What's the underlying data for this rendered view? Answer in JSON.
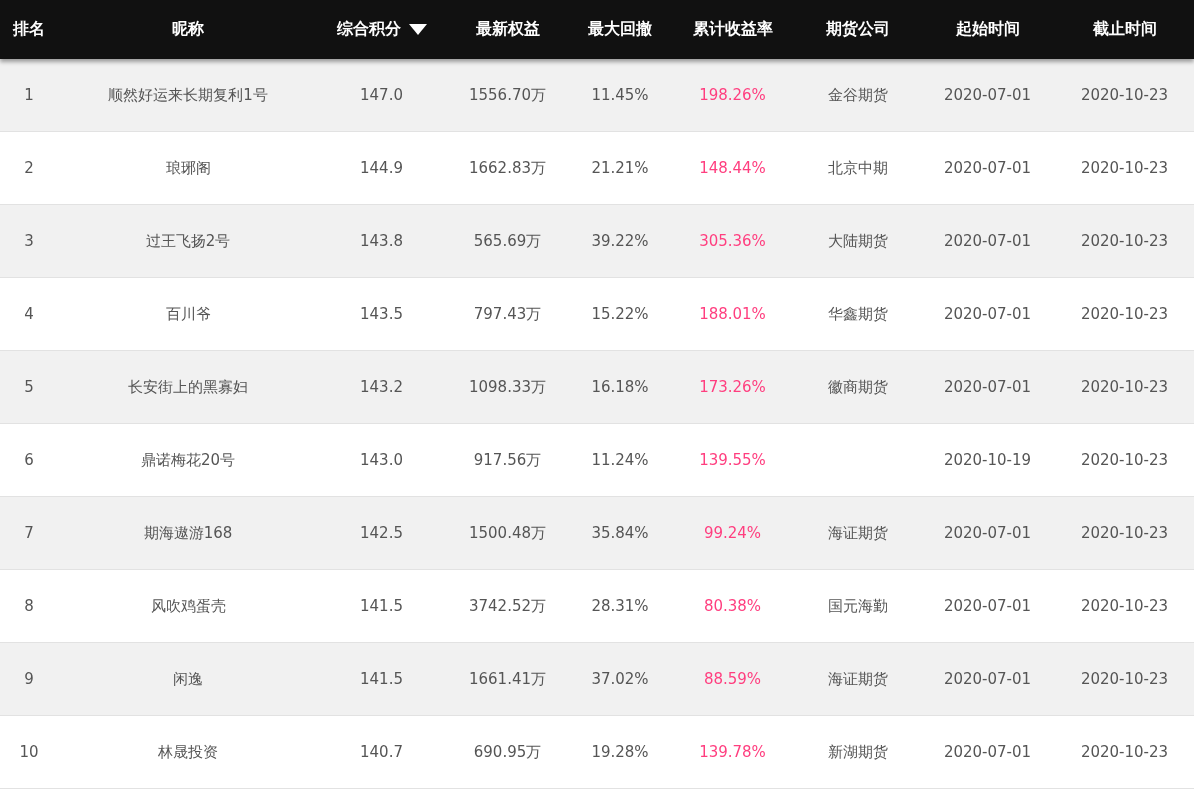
{
  "table": {
    "columns": [
      {
        "label": "排名",
        "sorted": false
      },
      {
        "label": "昵称",
        "sorted": false
      },
      {
        "label": "综合积分",
        "sorted": true
      },
      {
        "label": "最新权益",
        "sorted": false
      },
      {
        "label": "最大回撤",
        "sorted": false
      },
      {
        "label": "累计收益率",
        "sorted": false
      },
      {
        "label": "期货公司",
        "sorted": false
      },
      {
        "label": "起始时间",
        "sorted": false
      },
      {
        "label": "截止时间",
        "sorted": false
      }
    ],
    "rows": [
      {
        "rank": "1",
        "name": "顺然好运来长期复利1号",
        "score": "147.0",
        "equity": "1556.70万",
        "drawdown": "11.45%",
        "return": "198.26%",
        "company": "金谷期货",
        "start": "2020-07-01",
        "end": "2020-10-23"
      },
      {
        "rank": "2",
        "name": "琅琊阁",
        "score": "144.9",
        "equity": "1662.83万",
        "drawdown": "21.21%",
        "return": "148.44%",
        "company": "北京中期",
        "start": "2020-07-01",
        "end": "2020-10-23"
      },
      {
        "rank": "3",
        "name": "过王飞扬2号",
        "score": "143.8",
        "equity": "565.69万",
        "drawdown": "39.22%",
        "return": "305.36%",
        "company": "大陆期货",
        "start": "2020-07-01",
        "end": "2020-10-23"
      },
      {
        "rank": "4",
        "name": "百川爷",
        "score": "143.5",
        "equity": "797.43万",
        "drawdown": "15.22%",
        "return": "188.01%",
        "company": "华鑫期货",
        "start": "2020-07-01",
        "end": "2020-10-23"
      },
      {
        "rank": "5",
        "name": "长安街上的黑寡妇",
        "score": "143.2",
        "equity": "1098.33万",
        "drawdown": "16.18%",
        "return": "173.26%",
        "company": "徽商期货",
        "start": "2020-07-01",
        "end": "2020-10-23"
      },
      {
        "rank": "6",
        "name": "鼎诺梅花20号",
        "score": "143.0",
        "equity": "917.56万",
        "drawdown": "11.24%",
        "return": "139.55%",
        "start": "2020-10-19",
        "end": "2020-10-23"
      },
      {
        "rank": "7",
        "name": "期海遨游168",
        "score": "142.5",
        "equity": "1500.48万",
        "drawdown": "35.84%",
        "return": "99.24%",
        "company": "海证期货",
        "start": "2020-07-01",
        "end": "2020-10-23"
      },
      {
        "rank": "8",
        "name": "风吹鸡蛋壳",
        "score": "141.5",
        "equity": "3742.52万",
        "drawdown": "28.31%",
        "return": "80.38%",
        "company": "国元海勤",
        "start": "2020-07-01",
        "end": "2020-10-23"
      },
      {
        "rank": "9",
        "name": "闲逸",
        "score": "141.5",
        "equity": "1661.41万",
        "drawdown": "37.02%",
        "return": "88.59%",
        "company": "海证期货",
        "start": "2020-07-01",
        "end": "2020-10-23"
      },
      {
        "rank": "10",
        "name": "林晟投资",
        "score": "140.7",
        "equity": "690.95万",
        "drawdown": "19.28%",
        "return": "139.78%",
        "company": "新湖期货",
        "start": "2020-07-01",
        "end": "2020-10-23"
      }
    ]
  }
}
